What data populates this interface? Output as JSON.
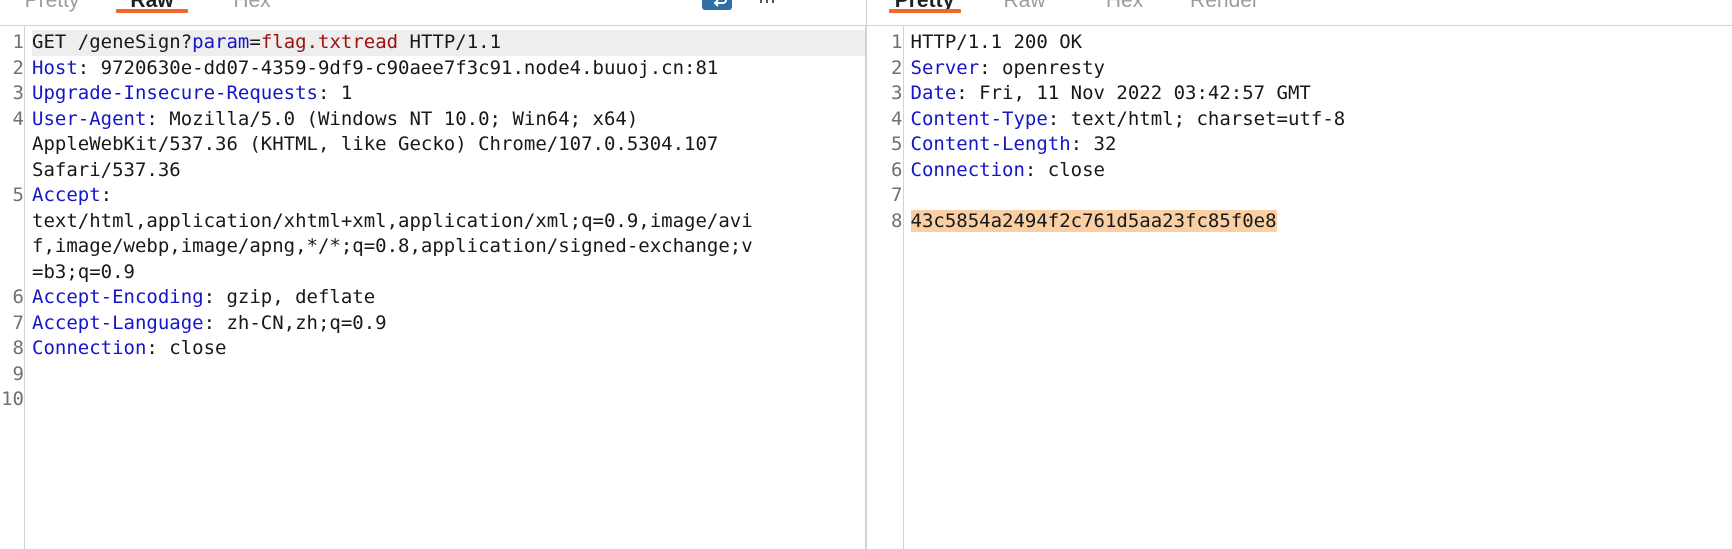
{
  "request_panel": {
    "name": "http-request",
    "tabs": [
      {
        "label": "Pretty",
        "active": false
      },
      {
        "label": "Raw",
        "active": true
      },
      {
        "label": "Hex",
        "active": false
      }
    ],
    "toolbar": {
      "wrap_icon": "word-wrap-icon",
      "search_icon": "filter-icon",
      "minimize_icon": "minimize-icon",
      "minimize_label": "—"
    },
    "line_numbers": [
      "1",
      "2",
      "3",
      "4",
      "",
      "",
      "5",
      "",
      "",
      "",
      "6",
      "7",
      "8",
      "9",
      "10"
    ],
    "lines": [
      {
        "n": "1",
        "selected": true,
        "segments": [
          {
            "text": "GET /geneSign?",
            "style": "plain"
          },
          {
            "text": "param",
            "style": "param"
          },
          {
            "text": "=",
            "style": "plain"
          },
          {
            "text": "flag.txtread",
            "style": "value"
          },
          {
            "text": " HTTP/1.1",
            "style": "plain"
          }
        ]
      },
      {
        "n": "2",
        "selected": false,
        "segments": [
          {
            "text": "Host",
            "style": "header"
          },
          {
            "text": ": 9720630e-dd07-4359-9df9-c90aee7f3c91.node4.buuoj.cn:81",
            "style": "plain"
          }
        ]
      },
      {
        "n": "3",
        "selected": false,
        "segments": [
          {
            "text": "Upgrade-Insecure-Requests",
            "style": "header"
          },
          {
            "text": ": 1",
            "style": "plain"
          }
        ]
      },
      {
        "n": "4",
        "selected": false,
        "segments": [
          {
            "text": "User-Agent",
            "style": "header"
          },
          {
            "text": ": Mozilla/5.0 (Windows NT 10.0; Win64; x64)",
            "style": "plain"
          }
        ]
      },
      {
        "n": "",
        "selected": false,
        "segments": [
          {
            "text": "AppleWebKit/537.36 (KHTML, like Gecko) Chrome/107.0.5304.107",
            "style": "plain"
          }
        ]
      },
      {
        "n": "",
        "selected": false,
        "segments": [
          {
            "text": "Safari/537.36",
            "style": "plain"
          }
        ]
      },
      {
        "n": "5",
        "selected": false,
        "segments": [
          {
            "text": "Accept",
            "style": "header"
          },
          {
            "text": ":",
            "style": "plain"
          }
        ]
      },
      {
        "n": "",
        "selected": false,
        "segments": [
          {
            "text": "text/html,application/xhtml+xml,application/xml;q=0.9,image/avi",
            "style": "plain"
          }
        ]
      },
      {
        "n": "",
        "selected": false,
        "segments": [
          {
            "text": "f,image/webp,image/apng,*/*;q=0.8,application/signed-exchange;v",
            "style": "plain"
          }
        ]
      },
      {
        "n": "",
        "selected": false,
        "segments": [
          {
            "text": "=b3;q=0.9",
            "style": "plain"
          }
        ]
      },
      {
        "n": "6",
        "selected": false,
        "segments": [
          {
            "text": "Accept-Encoding",
            "style": "header"
          },
          {
            "text": ": gzip, deflate",
            "style": "plain"
          }
        ]
      },
      {
        "n": "7",
        "selected": false,
        "segments": [
          {
            "text": "Accept-Language",
            "style": "header"
          },
          {
            "text": ": zh-CN,zh;q=0.9",
            "style": "plain"
          }
        ]
      },
      {
        "n": "8",
        "selected": false,
        "segments": [
          {
            "text": "Connection",
            "style": "header"
          },
          {
            "text": ": close",
            "style": "plain"
          }
        ]
      },
      {
        "n": "9",
        "selected": false,
        "segments": [
          {
            "text": "",
            "style": "plain"
          }
        ]
      },
      {
        "n": "10",
        "selected": false,
        "segments": [
          {
            "text": "",
            "style": "plain"
          }
        ]
      }
    ]
  },
  "response_panel": {
    "name": "http-response",
    "tabs": [
      {
        "label": "Pretty",
        "active": true
      },
      {
        "label": "Raw",
        "active": false
      },
      {
        "label": "Hex",
        "active": false
      },
      {
        "label": "Render",
        "active": false
      }
    ],
    "lines": [
      {
        "n": "1",
        "selected": false,
        "segments": [
          {
            "text": "HTTP/1.1 200 OK",
            "style": "plain"
          }
        ]
      },
      {
        "n": "2",
        "selected": false,
        "segments": [
          {
            "text": "Server",
            "style": "header"
          },
          {
            "text": ": openresty",
            "style": "plain"
          }
        ]
      },
      {
        "n": "3",
        "selected": false,
        "segments": [
          {
            "text": "Date",
            "style": "header"
          },
          {
            "text": ": Fri, 11 Nov 2022 03:42:57 GMT",
            "style": "plain"
          }
        ]
      },
      {
        "n": "4",
        "selected": false,
        "segments": [
          {
            "text": "Content-Type",
            "style": "header"
          },
          {
            "text": ": text/html; charset=utf-8",
            "style": "plain"
          }
        ]
      },
      {
        "n": "5",
        "selected": false,
        "segments": [
          {
            "text": "Content-Length",
            "style": "header"
          },
          {
            "text": ": 32",
            "style": "plain"
          }
        ]
      },
      {
        "n": "6",
        "selected": false,
        "segments": [
          {
            "text": "Connection",
            "style": "header"
          },
          {
            "text": ": close",
            "style": "plain"
          }
        ]
      },
      {
        "n": "7",
        "selected": false,
        "segments": [
          {
            "text": "",
            "style": "plain"
          }
        ]
      },
      {
        "n": "8",
        "selected": false,
        "segments": [
          {
            "text": "43c5854a2494f2c761d5aa23fc85f0e8",
            "style": "match"
          }
        ]
      }
    ]
  },
  "colors": {
    "accent": "#f5662d",
    "header_name": "#1414c8",
    "value_red": "#a01010",
    "match_highlight": "#fbcfa4",
    "selected_line": "#eeeeee",
    "toggle_blue": "#2f6fa3",
    "border": "#cfd3d6"
  }
}
